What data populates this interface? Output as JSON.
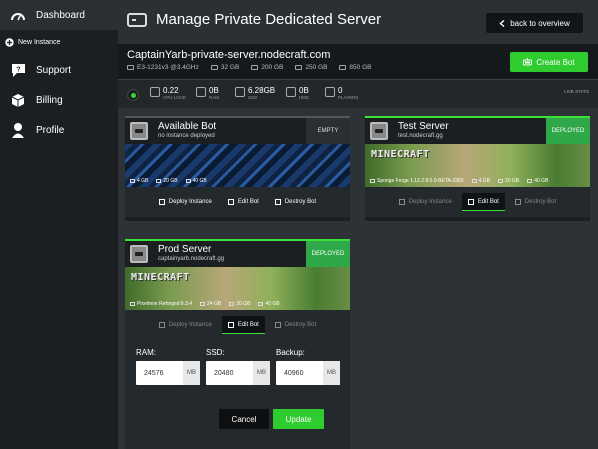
{
  "sidebar": {
    "items": [
      {
        "label": "Dashboard",
        "icon": "speedometer-icon"
      },
      {
        "label": "New Instance",
        "icon": "plus-circle-icon"
      },
      {
        "label": "Support",
        "icon": "speech-bubble-icon"
      },
      {
        "label": "Billing",
        "icon": "box-icon"
      },
      {
        "label": "Profile",
        "icon": "person-icon"
      }
    ]
  },
  "header": {
    "title": "Manage Private Dedicated Server",
    "back_label": "back to overview"
  },
  "server": {
    "name": "CaptainYarb-private-server.nodecraft.com",
    "cpu": "E3-1231v3 @3.4GHz",
    "ram": "32 GB",
    "ssd": "200 GB",
    "hdd": "250 GB",
    "bandwidth": "850 GB",
    "create_bot_label": "Create Bot"
  },
  "stats": {
    "cpu_value": "0.22",
    "cpu_label": "CPU LOAD",
    "ram_value": "0B",
    "ram_label": "RAM",
    "ssd_value": "6.28GB",
    "ssd_label": "SSD",
    "hdd_value": "0B",
    "hdd_label": "HDD",
    "players_value": "0",
    "players_label": "PLAYERS",
    "live_label": "LIVE STATS",
    "status_color": "#3cd33c"
  },
  "bots": [
    {
      "name": "Available Bot",
      "sub": "no instance deployed",
      "badge": "EMPTY",
      "ram": "4 GB",
      "ssd": "20 GB",
      "hdd": "40 GB",
      "actions": [
        "Deploy Instance",
        "Edit Bot",
        "Destroy Bot"
      ]
    },
    {
      "name": "Test Server",
      "sub": "test.nodecraft.gg",
      "badge": "DEPLOYED",
      "logo": "MINECRAFT",
      "game": "Sponge Forge 1.12.2 8.0.0-BETA-3362",
      "ram": "4 GB",
      "ssd": "20 GB",
      "hdd": "40 GB",
      "actions": [
        "Deploy Instance",
        "Edit Bot",
        "Destroy Bot"
      ]
    },
    {
      "name": "Prod Server",
      "sub": "captainyarb.nodecraft.gg",
      "badge": "DEPLOYED",
      "logo": "MINECRAFT",
      "game": "Pixelmon Reforged 6.3.4",
      "ram": "24 GB",
      "ssd": "20 GB",
      "hdd": "40 GB",
      "actions": [
        "Deploy Instance",
        "Edit Bot",
        "Destroy Bot"
      ]
    }
  ],
  "edit_form": {
    "ram_label": "RAM:",
    "ram_value": "24576",
    "ram_unit": "MB",
    "ssd_label": "SSD:",
    "ssd_value": "20480",
    "ssd_unit": "MB",
    "backup_label": "Backup:",
    "backup_value": "40960",
    "backup_unit": "MB",
    "cancel_label": "Cancel",
    "update_label": "Update"
  },
  "colors": {
    "accent": "#2ecc2e",
    "deployed": "#2fa84a",
    "sidebar": "#1c1f21"
  }
}
